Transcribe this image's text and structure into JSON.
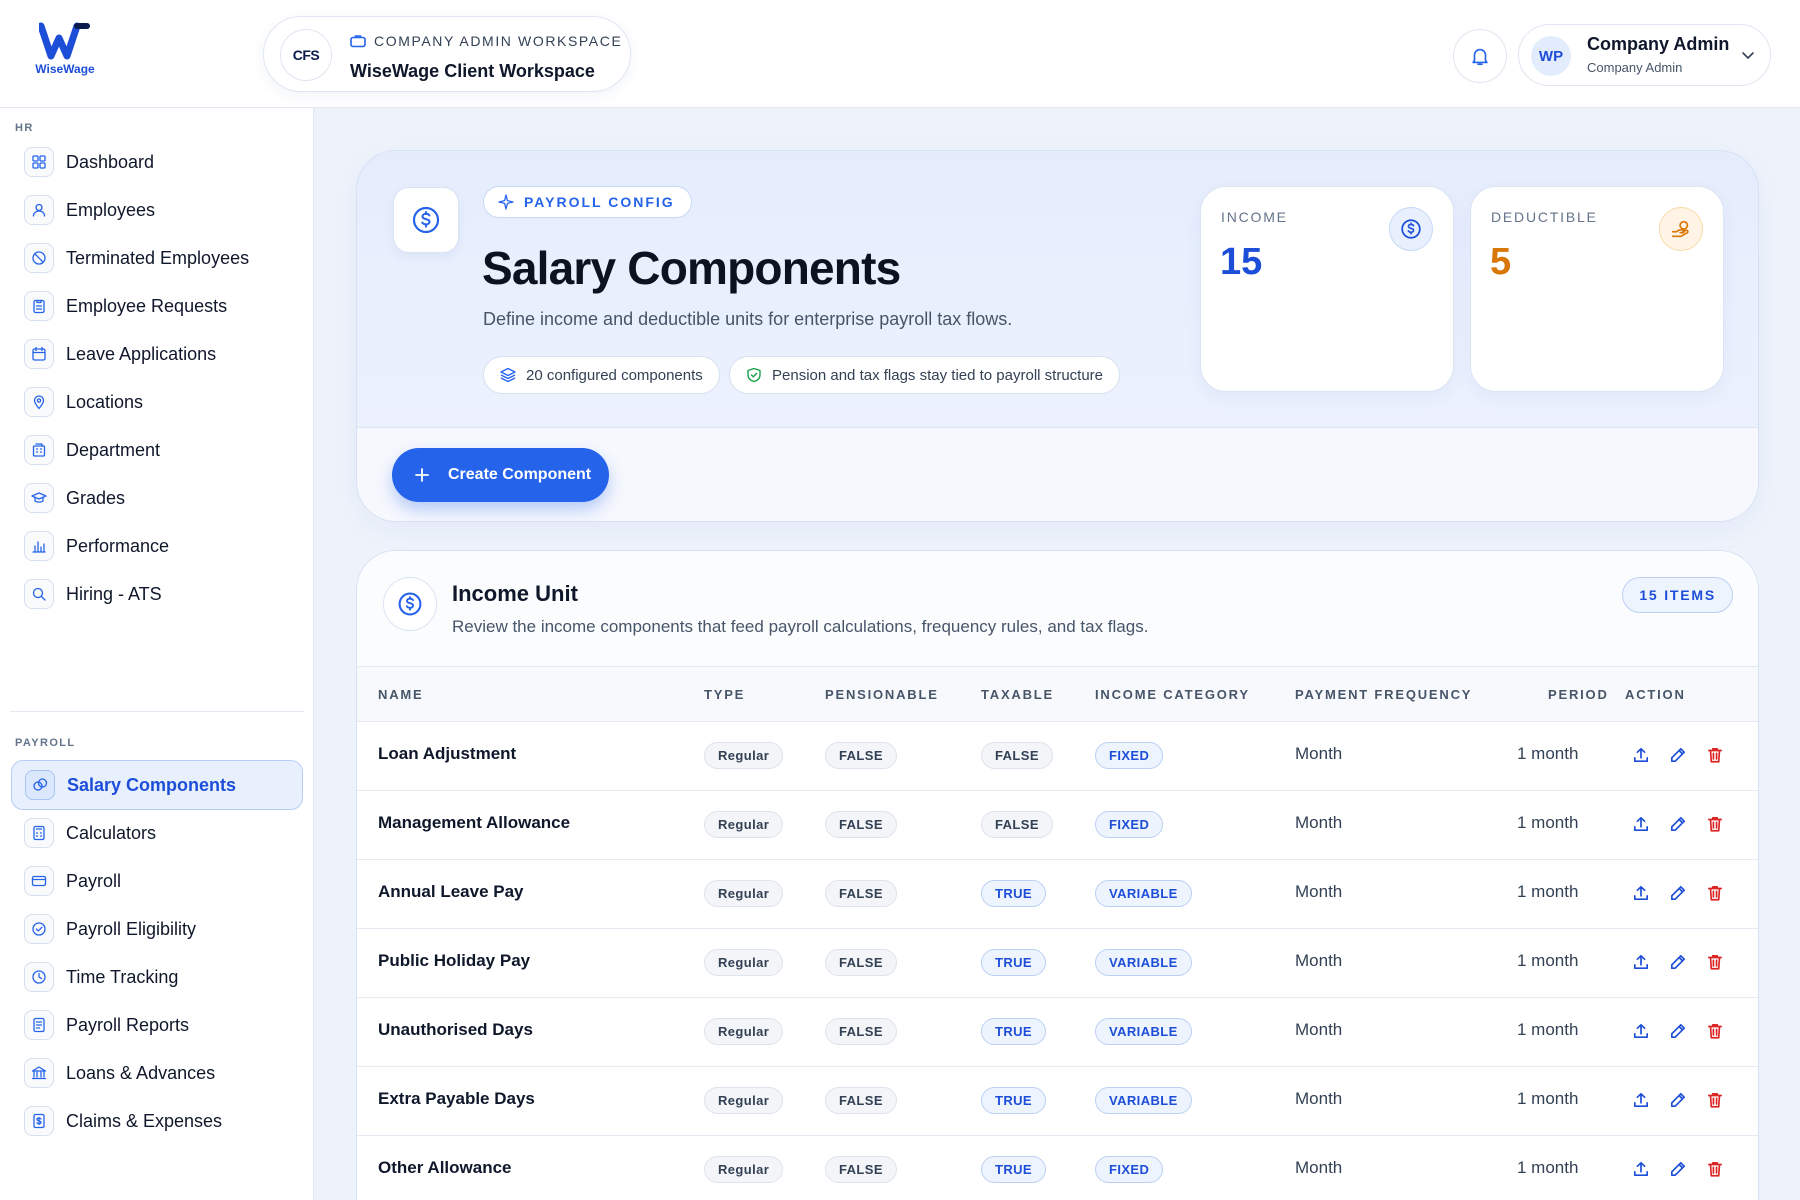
{
  "app": {
    "logo_text": "WiseWage",
    "workspace_kicker": "COMPANY ADMIN WORKSPACE",
    "workspace_title": "WiseWage Client Workspace",
    "client_logo_text": "CFS",
    "user": {
      "initials": "WP",
      "name": "Company Admin",
      "role": "Company Admin"
    }
  },
  "sidebar": {
    "hr_label": "HR",
    "hr_items": [
      {
        "label": "Dashboard",
        "icon": "grid-icon"
      },
      {
        "label": "Employees",
        "icon": "user-icon"
      },
      {
        "label": "Terminated Employees",
        "icon": "user-off-icon"
      },
      {
        "label": "Employee Requests",
        "icon": "clipboard-icon"
      },
      {
        "label": "Leave Applications",
        "icon": "calendar-icon"
      },
      {
        "label": "Locations",
        "icon": "map-pin-icon"
      },
      {
        "label": "Department",
        "icon": "building-icon"
      },
      {
        "label": "Grades",
        "icon": "graduation-cap-icon"
      },
      {
        "label": "Performance",
        "icon": "bar-chart-icon"
      },
      {
        "label": "Hiring - ATS",
        "icon": "search-icon"
      }
    ],
    "payroll_label": "PAYROLL",
    "payroll_items": [
      {
        "label": "Salary Components",
        "icon": "coins-icon",
        "active": true
      },
      {
        "label": "Calculators",
        "icon": "calculator-icon"
      },
      {
        "label": "Payroll",
        "icon": "card-icon"
      },
      {
        "label": "Payroll Eligibility",
        "icon": "check-circle-icon"
      },
      {
        "label": "Time Tracking",
        "icon": "clock-icon"
      },
      {
        "label": "Payroll Reports",
        "icon": "report-icon"
      },
      {
        "label": "Loans & Advances",
        "icon": "bank-icon"
      },
      {
        "label": "Claims & Expenses",
        "icon": "receipt-icon"
      }
    ]
  },
  "hero": {
    "badge": "PAYROLL CONFIG",
    "title": "Salary Components",
    "subtitle": "Define income and deductible units for enterprise payroll tax flows.",
    "chip_count": "20 configured components",
    "chip_note": "Pension and tax flags stay tied to payroll structure",
    "create_button": "Create Component",
    "stats": [
      {
        "label": "INCOME",
        "value": "15",
        "color": "#1d4ed8",
        "icon": "dollar-circle-icon"
      },
      {
        "label": "DEDUCTIBLE",
        "value": "5",
        "color": "#d97706",
        "icon": "hand-coins-icon"
      }
    ]
  },
  "income": {
    "title": "Income Unit",
    "subtitle": "Review the income components that feed payroll calculations, frequency rules, and tax flags.",
    "badge": "15 ITEMS",
    "columns": [
      "NAME",
      "TYPE",
      "PENSIONABLE",
      "TAXABLE",
      "INCOME CATEGORY",
      "PAYMENT FREQUENCY",
      "PERIOD",
      "ACTION"
    ],
    "rows": [
      {
        "name": "Loan Adjustment",
        "type": "Regular",
        "pensionable": "FALSE",
        "taxable": "FALSE",
        "category": "FIXED",
        "frequency": "Month",
        "period": "1 month"
      },
      {
        "name": "Management Allowance",
        "type": "Regular",
        "pensionable": "FALSE",
        "taxable": "FALSE",
        "category": "FIXED",
        "frequency": "Month",
        "period": "1 month"
      },
      {
        "name": "Annual Leave Pay",
        "type": "Regular",
        "pensionable": "FALSE",
        "taxable": "TRUE",
        "category": "VARIABLE",
        "frequency": "Month",
        "period": "1 month"
      },
      {
        "name": "Public Holiday Pay",
        "type": "Regular",
        "pensionable": "FALSE",
        "taxable": "TRUE",
        "category": "VARIABLE",
        "frequency": "Month",
        "period": "1 month"
      },
      {
        "name": "Unauthorised Days",
        "type": "Regular",
        "pensionable": "FALSE",
        "taxable": "TRUE",
        "category": "VARIABLE",
        "frequency": "Month",
        "period": "1 month"
      },
      {
        "name": "Extra Payable Days",
        "type": "Regular",
        "pensionable": "FALSE",
        "taxable": "TRUE",
        "category": "VARIABLE",
        "frequency": "Month",
        "period": "1 month"
      },
      {
        "name": "Other Allowance",
        "type": "Regular",
        "pensionable": "FALSE",
        "taxable": "TRUE",
        "category": "FIXED",
        "frequency": "Month",
        "period": "1 month"
      }
    ]
  },
  "colors": {
    "accent": "#2563eb",
    "deductible": "#d97706",
    "danger": "#dc2626"
  }
}
